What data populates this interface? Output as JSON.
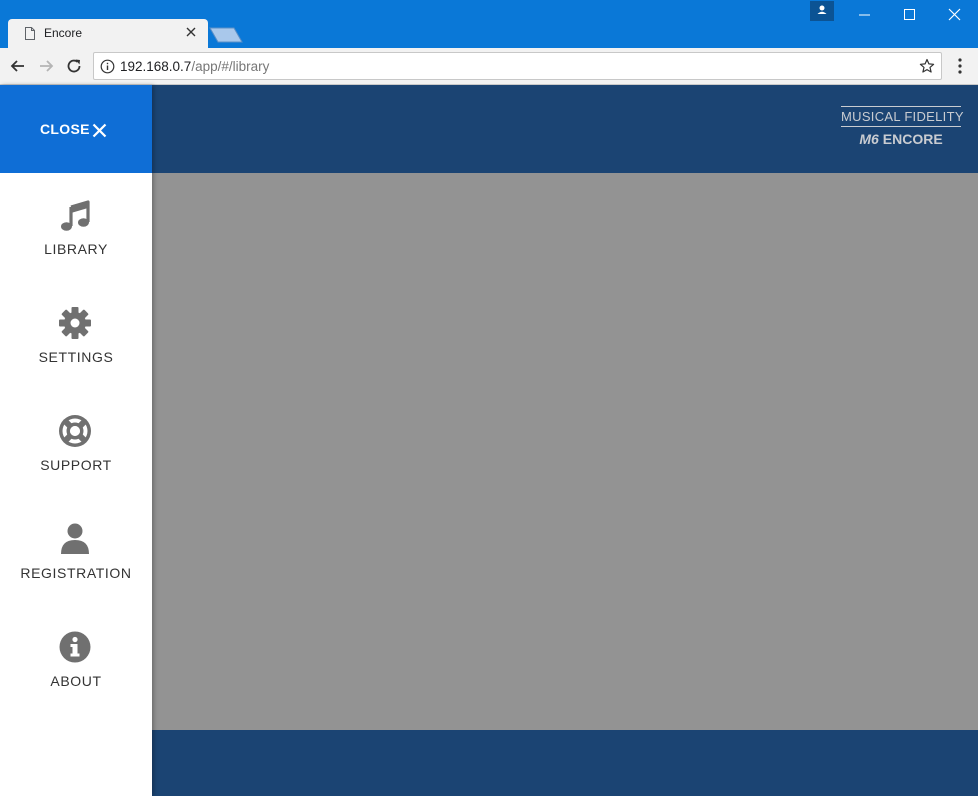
{
  "browser": {
    "tab_title": "Encore",
    "url_host": "192.168.0.7",
    "url_path": "/app/#/library"
  },
  "brand": {
    "line1": "MUSICAL FIDELITY",
    "line2_prefix": "M6",
    "line2": "ENCORE"
  },
  "sidebar": {
    "close_label": "CLOSE",
    "items": [
      {
        "label": "LIBRARY",
        "icon": "music-note-icon"
      },
      {
        "label": "SETTINGS",
        "icon": "gear-icon"
      },
      {
        "label": "SUPPORT",
        "icon": "lifebuoy-icon"
      },
      {
        "label": "REGISTRATION",
        "icon": "user-icon"
      },
      {
        "label": "ABOUT",
        "icon": "info-icon"
      }
    ]
  },
  "colors": {
    "titlebar": "#0a78d7",
    "header": "#1b4473",
    "close_button": "#0f6ed6",
    "overlay": "#939393",
    "icon": "#707070"
  }
}
